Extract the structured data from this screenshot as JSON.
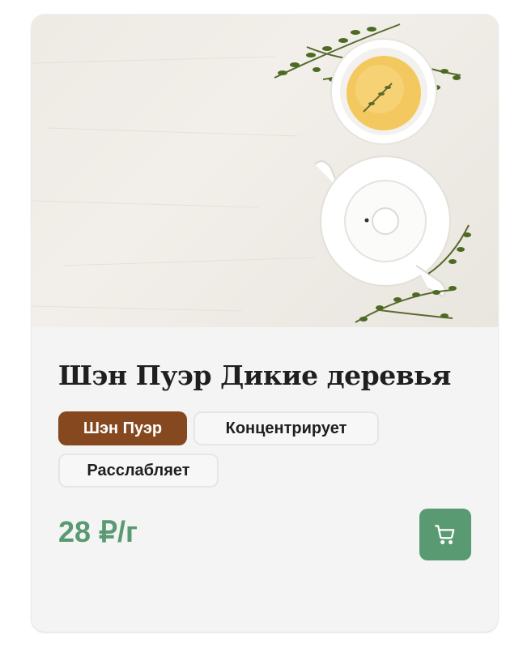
{
  "product": {
    "title": "Шэн Пуэр Дикие деревья",
    "image_alt": "Белый чайник и чашка чая с веточками тимьяна",
    "tags": [
      {
        "label": "Шэн Пуэр",
        "style": "primary"
      },
      {
        "label": "Концентрирует",
        "style": "secondary"
      },
      {
        "label": "Расслабляет",
        "style": "secondary"
      }
    ],
    "price": "28 ₽/г"
  },
  "icons": {
    "cart_button_icon": "shopping-cart-icon"
  },
  "colors": {
    "tag_primary_bg": "#86491f",
    "accent_green": "#5a9a72",
    "card_bg": "#f4f4f4"
  }
}
